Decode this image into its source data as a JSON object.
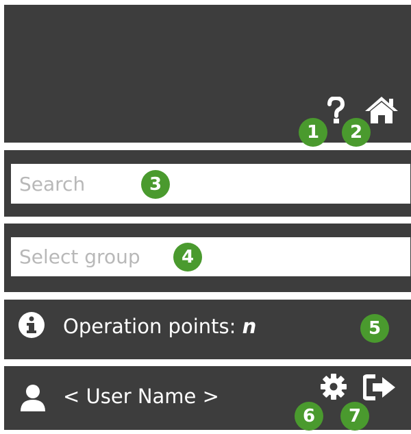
{
  "header": {
    "help_icon": "question-mark-icon",
    "home_icon": "home-icon",
    "badges": {
      "help": "1",
      "home": "2"
    }
  },
  "search": {
    "placeholder": "Search",
    "value": "",
    "badge": "3"
  },
  "group_select": {
    "placeholder": "Select group",
    "value": "",
    "badge": "4"
  },
  "info": {
    "icon": "info-icon",
    "label": "Operation points:",
    "value": "n",
    "badge": "5"
  },
  "user": {
    "icon": "user-icon",
    "name": "< User Name >",
    "settings_icon": "gear-icon",
    "logout_icon": "logout-icon",
    "badges": {
      "settings": "6",
      "logout": "7"
    }
  },
  "colors": {
    "panel_bg": "#3d3d3d",
    "badge_green": "#4a9a2e",
    "icon_white": "#ffffff",
    "placeholder": "#b8b8b8"
  }
}
